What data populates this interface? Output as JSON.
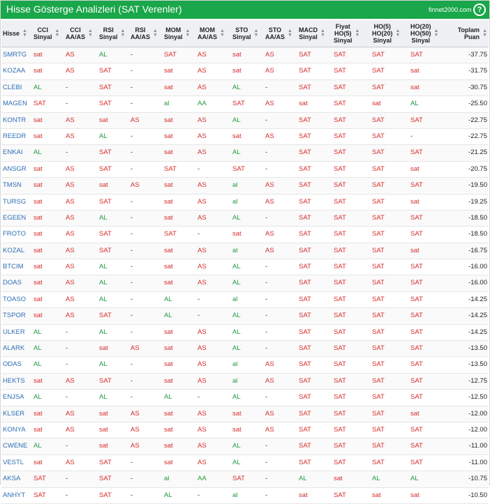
{
  "header": {
    "title": "Hisse Gösterge Analizleri (SAT Verenler)",
    "site": "finnet2000.com",
    "help_label": "?"
  },
  "columns": [
    "Hisse",
    "CCI\nSinyal",
    "CCI\nAA/AS",
    "RSI\nSinyal",
    "RSI\nAA/AS",
    "MOM\nSinyal",
    "MOM\nAA/AS",
    "STO\nSinyal",
    "STO\nAA/AS",
    "MACD\nSinyal",
    "Fiyat\nHO(5)\nSinyal",
    "HO(5)\nHO(20)\nSinyal",
    "HO(20)\nHO(50)\nSinyal",
    "Toplam\nPuan"
  ],
  "rows": [
    [
      "SMRTG",
      "sat",
      "AS",
      "AL",
      "-",
      "SAT",
      "AS",
      "sat",
      "AS",
      "SAT",
      "SAT",
      "SAT",
      "SAT",
      "-37.75"
    ],
    [
      "KOZAA",
      "sat",
      "AS",
      "SAT",
      "-",
      "sat",
      "AS",
      "sat",
      "AS",
      "SAT",
      "SAT",
      "SAT",
      "sat",
      "-31.75"
    ],
    [
      "CLEBI",
      "AL",
      "-",
      "SAT",
      "-",
      "sat",
      "AS",
      "AL",
      "-",
      "SAT",
      "SAT",
      "SAT",
      "sat",
      "-30.75"
    ],
    [
      "MAGEN",
      "SAT",
      "-",
      "SAT",
      "-",
      "al",
      "AA",
      "SAT",
      "AS",
      "sat",
      "SAT",
      "sat",
      "AL",
      "-25.50"
    ],
    [
      "KONTR",
      "sat",
      "AS",
      "sat",
      "AS",
      "sat",
      "AS",
      "AL",
      "-",
      "SAT",
      "SAT",
      "SAT",
      "SAT",
      "-22.75"
    ],
    [
      "REEDR",
      "sat",
      "AS",
      "AL",
      "-",
      "sat",
      "AS",
      "sat",
      "AS",
      "SAT",
      "SAT",
      "SAT",
      "-",
      "-22.75"
    ],
    [
      "ENKAI",
      "AL",
      "-",
      "SAT",
      "-",
      "sat",
      "AS",
      "AL",
      "-",
      "SAT",
      "SAT",
      "SAT",
      "SAT",
      "-21.25"
    ],
    [
      "ANSGR",
      "sat",
      "AS",
      "SAT",
      "-",
      "SAT",
      "-",
      "SAT",
      "-",
      "SAT",
      "SAT",
      "SAT",
      "sat",
      "-20.75"
    ],
    [
      "TMSN",
      "sat",
      "AS",
      "sat",
      "AS",
      "sat",
      "AS",
      "al",
      "AS",
      "SAT",
      "SAT",
      "SAT",
      "SAT",
      "-19.50"
    ],
    [
      "TURSG",
      "sat",
      "AS",
      "SAT",
      "-",
      "sat",
      "AS",
      "al",
      "AS",
      "SAT",
      "SAT",
      "SAT",
      "sat",
      "-19.25"
    ],
    [
      "EGEEN",
      "sat",
      "AS",
      "AL",
      "-",
      "sat",
      "AS",
      "AL",
      "-",
      "SAT",
      "SAT",
      "SAT",
      "SAT",
      "-18.50"
    ],
    [
      "FROTO",
      "sat",
      "AS",
      "SAT",
      "-",
      "SAT",
      "-",
      "sat",
      "AS",
      "SAT",
      "SAT",
      "SAT",
      "SAT",
      "-18.50"
    ],
    [
      "KOZAL",
      "sat",
      "AS",
      "SAT",
      "-",
      "sat",
      "AS",
      "al",
      "AS",
      "SAT",
      "SAT",
      "SAT",
      "sat",
      "-16.75"
    ],
    [
      "BTCIM",
      "sat",
      "AS",
      "AL",
      "-",
      "sat",
      "AS",
      "AL",
      "-",
      "SAT",
      "SAT",
      "SAT",
      "SAT",
      "-16.00"
    ],
    [
      "DOAS",
      "sat",
      "AS",
      "AL",
      "-",
      "sat",
      "AS",
      "AL",
      "-",
      "SAT",
      "SAT",
      "SAT",
      "SAT",
      "-16.00"
    ],
    [
      "TOASO",
      "sat",
      "AS",
      "AL",
      "-",
      "AL",
      "-",
      "al",
      "-",
      "SAT",
      "SAT",
      "SAT",
      "SAT",
      "-14.25"
    ],
    [
      "TSPOR",
      "sat",
      "AS",
      "SAT",
      "-",
      "AL",
      "-",
      "AL",
      "-",
      "SAT",
      "SAT",
      "SAT",
      "SAT",
      "-14.25"
    ],
    [
      "ULKER",
      "AL",
      "-",
      "AL",
      "-",
      "sat",
      "AS",
      "AL",
      "-",
      "SAT",
      "SAT",
      "SAT",
      "SAT",
      "-14.25"
    ],
    [
      "ALARK",
      "AL",
      "-",
      "sat",
      "AS",
      "sat",
      "AS",
      "AL",
      "-",
      "SAT",
      "SAT",
      "SAT",
      "SAT",
      "-13.50"
    ],
    [
      "ODAS",
      "AL",
      "-",
      "AL",
      "-",
      "sat",
      "AS",
      "al",
      "AS",
      "SAT",
      "SAT",
      "SAT",
      "SAT",
      "-13.50"
    ],
    [
      "HEKTS",
      "sat",
      "AS",
      "SAT",
      "-",
      "sat",
      "AS",
      "al",
      "AS",
      "SAT",
      "SAT",
      "SAT",
      "SAT",
      "-12.75"
    ],
    [
      "ENJSA",
      "AL",
      "-",
      "AL",
      "-",
      "AL",
      "-",
      "AL",
      "-",
      "SAT",
      "SAT",
      "SAT",
      "SAT",
      "-12.50"
    ],
    [
      "KLSER",
      "sat",
      "AS",
      "sat",
      "AS",
      "sat",
      "AS",
      "sat",
      "AS",
      "SAT",
      "SAT",
      "SAT",
      "sat",
      "-12.00"
    ],
    [
      "KONYA",
      "sat",
      "AS",
      "sat",
      "AS",
      "sat",
      "AS",
      "sat",
      "AS",
      "SAT",
      "SAT",
      "SAT",
      "SAT",
      "-12.00"
    ],
    [
      "CWENE",
      "AL",
      "-",
      "sat",
      "AS",
      "sat",
      "AS",
      "AL",
      "-",
      "SAT",
      "SAT",
      "SAT",
      "SAT",
      "-11.00"
    ],
    [
      "VESTL",
      "sat",
      "AS",
      "SAT",
      "-",
      "sat",
      "AS",
      "AL",
      "-",
      "SAT",
      "SAT",
      "SAT",
      "SAT",
      "-11.00"
    ],
    [
      "AKSA",
      "SAT",
      "-",
      "SAT",
      "-",
      "al",
      "AA",
      "SAT",
      "-",
      "AL",
      "sat",
      "AL",
      "AL",
      "-10.75"
    ],
    [
      "ANHYT",
      "SAT",
      "-",
      "SAT",
      "-",
      "AL",
      "-",
      "al",
      "-",
      "sat",
      "SAT",
      "sat",
      "sat",
      "-10.50"
    ]
  ],
  "colors": {
    "header_bg": "#1aa64a",
    "buy": "#1f9a3d",
    "sell": "#d62b2b",
    "ticker": "#2d6db5"
  }
}
